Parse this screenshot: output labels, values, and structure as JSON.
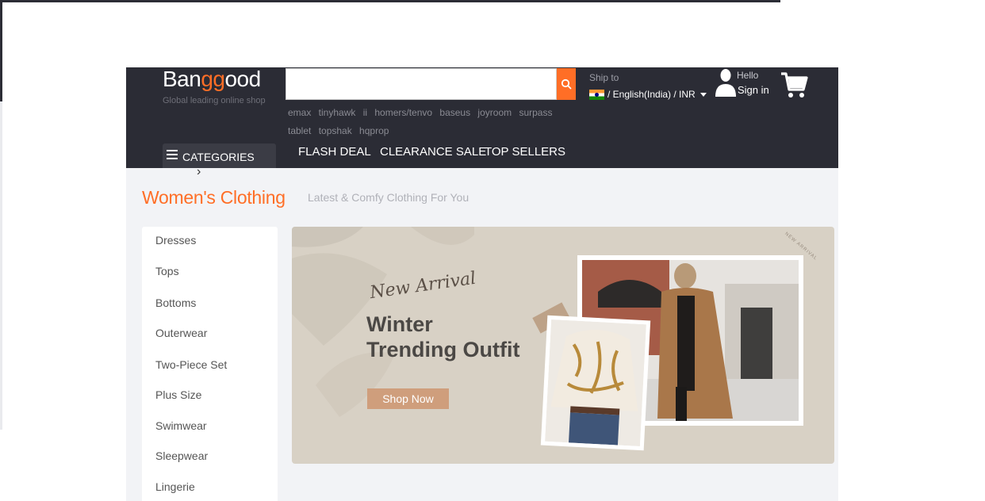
{
  "header": {
    "logo_part1": "Ban",
    "logo_part2": "gg",
    "logo_part3": "ood",
    "tagline": "Global leading online shop",
    "search_placeholder": "",
    "hot_searches": "emax tinyhawk ii  homers/tenvo  baseus  joyroom  surpass  tablet  topshak  hqprop",
    "ship_to_label": "Ship to",
    "language_currency": "/ English(India) / INR",
    "hello_text": "Hello",
    "sign_in_text": "Sign in",
    "categories_label": "CATEGORIES",
    "nav": [
      "FLASH DEAL",
      "CLEARANCE SALE",
      "TOP SELLERS"
    ]
  },
  "section": {
    "title": "Women's Clothing",
    "subtitle": "Latest & Comfy Clothing For You"
  },
  "sidebar": {
    "items": [
      "Dresses",
      "Tops",
      "Bottoms",
      "Outerwear",
      "Two-Piece Set",
      "Plus Size",
      "Swimwear",
      "Sleepwear",
      "Lingerie"
    ]
  },
  "banner": {
    "script_text": "New Arrival",
    "headline_line1": "Winter",
    "headline_line2": "Trending Outfit",
    "button_label": "Shop Now",
    "stamp_text": "NEW ARRIVAL"
  },
  "colors": {
    "header_bg": "#2b2c35",
    "accent": "#ff6e26",
    "content_bg": "#f2f3f6",
    "banner_bg": "#d8d1c5",
    "button_bg": "#cf9e7c"
  },
  "icons": [
    "search-icon",
    "user-icon",
    "cart-icon",
    "menu-icon",
    "chevron-right-icon",
    "caret-down-icon",
    "india-flag-icon"
  ]
}
